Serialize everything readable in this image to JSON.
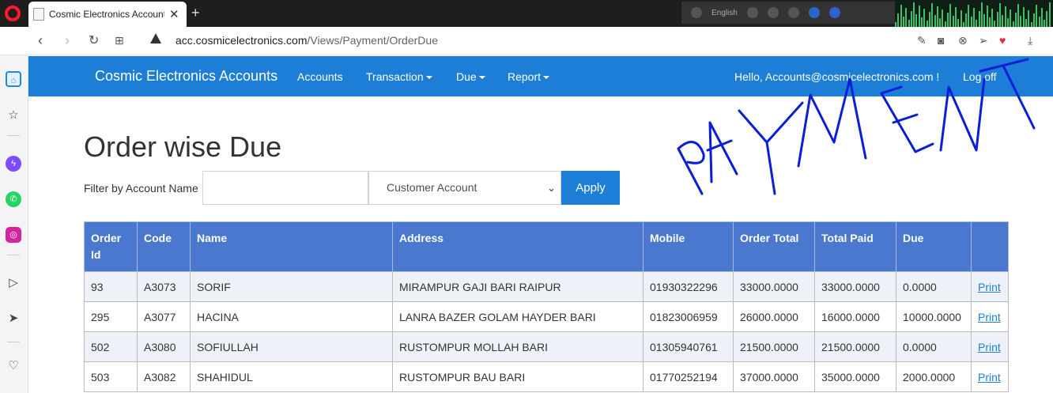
{
  "browser": {
    "tab_title": "Cosmic Electronics Account",
    "url_host": "acc.cosmicelectronics.com",
    "url_path": "/Views/Payment/OrderDue",
    "tray_language": "English"
  },
  "navbar": {
    "brand": "Cosmic Electronics Accounts",
    "items": [
      "Accounts",
      "Transaction",
      "Due",
      "Report"
    ],
    "greeting": "Hello, Accounts@cosmicelectronics.com !",
    "logoff": "Log off"
  },
  "annotation": {
    "handwriting": "PAYMENT",
    "color": "#0a1ed8"
  },
  "page": {
    "title": "Order wise Due",
    "filter_label": "Filter by Account Name",
    "filter_value": "",
    "account_type": "Customer Account",
    "apply_label": "Apply"
  },
  "table": {
    "headers": [
      "Order Id",
      "Code",
      "Name",
      "Address",
      "Mobile",
      "Order Total",
      "Total Paid",
      "Due",
      ""
    ],
    "rows": [
      [
        "93",
        "A3073",
        "SORIF",
        "MIRAMPUR GAJI BARI RAIPUR",
        "01930322296",
        "33000.0000",
        "33000.0000",
        "0.0000",
        "Print"
      ],
      [
        "295",
        "A3077",
        "HACINA",
        "LANRA BAZER GOLAM HAYDER BARI",
        "01823006959",
        "26000.0000",
        "16000.0000",
        "10000.0000",
        "Print"
      ],
      [
        "502",
        "A3080",
        "SOFIULLAH",
        "RUSTOMPUR MOLLAH BARI",
        "01305940761",
        "21500.0000",
        "21500.0000",
        "0.0000",
        "Print"
      ],
      [
        "503",
        "A3082",
        "SHAHIDUL",
        "RUSTOMPUR BAU BARI",
        "01770252194",
        "37000.0000",
        "35000.0000",
        "2000.0000",
        "Print"
      ]
    ]
  },
  "colors": {
    "primary": "#1c7ed6",
    "table_header": "#4a78cf"
  }
}
